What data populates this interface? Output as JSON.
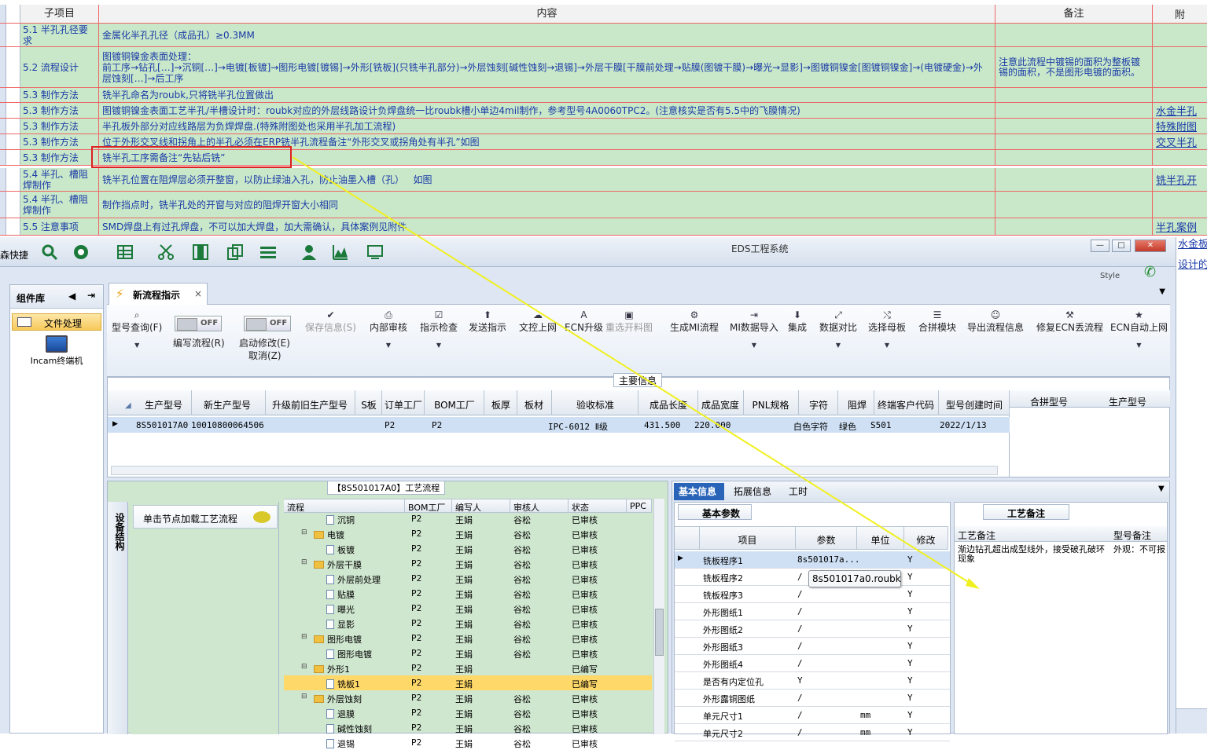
{
  "sheet": {
    "headers": {
      "sub": "子项目",
      "content": "内容",
      "remark": "备注",
      "attach": "附"
    },
    "rows": [
      {
        "sub": "5.1 半孔孔径要求",
        "content": "金属化半孔孔径（成品孔）≥0.3MM",
        "remark": "",
        "attach": ""
      },
      {
        "sub": "5.2 流程设计",
        "content": "图镀铜镍金表面处理：\n前工序→钻孔[…]→沉铜[…]→电镀[板镀]→图形电镀[镀锡]→外形[铣板](只铣半孔部分)→外层蚀刻[碱性蚀刻→退锡]→外层干膜[干膜前处理→贴膜(图镀干膜)→曝光→显影]→图镀铜镍金[图镀铜镍金]→(电镀硬金)→外层蚀刻[…]→后工序",
        "remark": "注意此流程中镀锡的面积为整板镀锡的面积，不是图形电镀的面积。",
        "attach": ""
      },
      {
        "sub": "5.3 制作方法",
        "content": "铣半孔命名为roubk,只将铣半孔位置做出",
        "remark": "",
        "attach": ""
      },
      {
        "sub": "5.3 制作方法",
        "content": "图镀铜镍金表面工艺半孔/半槽设计时：roubk对应的外层线路设计负焊盘统一比roubk槽小单边4mil制作，参考型号4A0060TPC2。(注意核实是否有5.5中的飞膜情况)",
        "remark": "",
        "attach": "水金半孔"
      },
      {
        "sub": "5.3 制作方法",
        "content": "半孔板外部分对应线路层为负焊焊盘.(特殊附图处也采用半孔加工流程)",
        "remark": "",
        "attach": "特殊附图"
      },
      {
        "sub": "5.3 制作方法",
        "content": "位于外形交叉线和拐角上的半孔必须在ERP铣半孔流程备注“外形交叉或拐角处有半孔”如图",
        "remark": "",
        "attach": "交叉半孔"
      },
      {
        "sub": "5.3 制作方法",
        "content": "铣半孔工序需备注“先钻后铣”",
        "remark": "",
        "attach": ""
      },
      {
        "sub": "5.4 半孔、槽阻焊制作",
        "content": "铣半孔位置在阻焊层必须开整窗，以防止绿油入孔，防止油墨入槽（孔）   如图",
        "remark": "",
        "attach": "铣半孔开"
      },
      {
        "sub": "5.4 半孔、槽阻焊制作",
        "content": "制作挡点时，铣半孔处的开窗与对应的阻焊开窗大小相同",
        "remark": "",
        "attach": ""
      },
      {
        "sub": "5.5 注意事项",
        "content": "SMD焊盘上有过孔焊盘，不可以加大焊盘，加大需确认，具体案例见附件",
        "remark": "",
        "attach": "半孔案例"
      }
    ]
  },
  "app": {
    "quick_label": "森快捷",
    "title": "EDS工程系统",
    "style_label": "Style",
    "window_controls": [
      "—",
      "□",
      "✕"
    ],
    "toolbar_icons": [
      "search-icon",
      "globe-icon",
      "table-icon",
      "scissors-icon",
      "film-icon",
      "copy-icon",
      "list-icon",
      "user-icon",
      "chart-icon",
      "monitor-icon"
    ]
  },
  "left": {
    "header": "组件库",
    "item": "文件处理",
    "terminal": "Incam终端机"
  },
  "tab": {
    "label": "新流程指示",
    "close": "×"
  },
  "ribbon": {
    "query": "型号查询(F)",
    "toggle1": "OFF",
    "toggle2": "OFF",
    "edit_flow": "编写流程(R)",
    "start_edit": "启动修改(E)",
    "cancel": "取消(Z)",
    "save": "保存信息(S)",
    "buttons": [
      "内部审核",
      "指示检查",
      "发送指示",
      "文控上网",
      "ECN升级",
      "重选开料图",
      "生成MI流程",
      "MI数据导入",
      "集成",
      "数据对比",
      "选择母板",
      "合拼模块",
      "导出流程信息",
      "修复ECN丢流程",
      "ECN自动上网"
    ]
  },
  "main_info": {
    "label": "主要信息",
    "headers": [
      "生产型号",
      "新生产型号",
      "升级前旧生产型号",
      "S板",
      "订单工厂",
      "BOM工厂",
      "板厚",
      "板材",
      "验收标准",
      "成品长度",
      "成品宽度",
      "PNL规格",
      "字符",
      "阻焊",
      "终端客户代码",
      "型号创建时间"
    ],
    "row": [
      "8S501017A0",
      "10010800064506",
      "",
      "",
      "P2",
      "P2",
      "",
      "",
      "IPC-6012 Ⅱ级",
      "431.500",
      "220.000",
      "",
      "白色字符",
      "绿色",
      "S501",
      "2022/1/13"
    ],
    "side_headers": [
      "合拼型号",
      "生产型号"
    ]
  },
  "flow": {
    "title": "【8S501017A0】工艺流程",
    "side_tab": "设备结构",
    "load_btn": "单击节点加载工艺流程",
    "headers": [
      "流程",
      "BOM工厂",
      "编写人",
      "审核人",
      "状态",
      "PPC"
    ],
    "rows": [
      {
        "level": 2,
        "kind": "file",
        "name": "沉铜",
        "bom": "P2",
        "writer": "王娟",
        "reviewer": "谷松",
        "status": "已审核"
      },
      {
        "level": 1,
        "kind": "folder",
        "name": "电镀",
        "bom": "P2",
        "writer": "王娟",
        "reviewer": "谷松",
        "status": "已审核"
      },
      {
        "level": 2,
        "kind": "file",
        "name": "板镀",
        "bom": "P2",
        "writer": "王娟",
        "reviewer": "谷松",
        "status": "已审核"
      },
      {
        "level": 1,
        "kind": "folder",
        "name": "外层干膜",
        "bom": "P2",
        "writer": "王娟",
        "reviewer": "谷松",
        "status": "已审核"
      },
      {
        "level": 2,
        "kind": "file",
        "name": "外层前处理",
        "bom": "P2",
        "writer": "王娟",
        "reviewer": "谷松",
        "status": "已审核"
      },
      {
        "level": 2,
        "kind": "file",
        "name": "贴膜",
        "bom": "P2",
        "writer": "王娟",
        "reviewer": "谷松",
        "status": "已审核"
      },
      {
        "level": 2,
        "kind": "file",
        "name": "曝光",
        "bom": "P2",
        "writer": "王娟",
        "reviewer": "谷松",
        "status": "已审核"
      },
      {
        "level": 2,
        "kind": "file",
        "name": "显影",
        "bom": "P2",
        "writer": "王娟",
        "reviewer": "谷松",
        "status": "已审核"
      },
      {
        "level": 1,
        "kind": "folder",
        "name": "图形电镀",
        "bom": "P2",
        "writer": "王娟",
        "reviewer": "谷松",
        "status": "已审核"
      },
      {
        "level": 2,
        "kind": "file",
        "name": "图形电镀",
        "bom": "P2",
        "writer": "王娟",
        "reviewer": "谷松",
        "status": "已审核"
      },
      {
        "level": 1,
        "kind": "folder",
        "name": "外形1",
        "bom": "P2",
        "writer": "王娟",
        "reviewer": "",
        "status": "已编写"
      },
      {
        "level": 2,
        "kind": "file",
        "name": "铣板1",
        "bom": "P2",
        "writer": "王娟",
        "reviewer": "",
        "status": "已编写",
        "selected": true
      },
      {
        "level": 1,
        "kind": "folder",
        "name": "外层蚀刻",
        "bom": "P2",
        "writer": "王娟",
        "reviewer": "谷松",
        "status": "已审核"
      },
      {
        "level": 2,
        "kind": "file",
        "name": "退膜",
        "bom": "P2",
        "writer": "王娟",
        "reviewer": "谷松",
        "status": "已审核"
      },
      {
        "level": 2,
        "kind": "file",
        "name": "碱性蚀刻",
        "bom": "P2",
        "writer": "王娟",
        "reviewer": "谷松",
        "status": "已审核"
      },
      {
        "level": 2,
        "kind": "file",
        "name": "退锡",
        "bom": "P2",
        "writer": "王娟",
        "reviewer": "谷松",
        "status": "已审核"
      }
    ]
  },
  "details": {
    "tabs": [
      "基本信息",
      "拓展信息",
      "工时"
    ],
    "param_tab": "基本参数",
    "headers": [
      "项目",
      "参数",
      "单位",
      "修改"
    ],
    "rows": [
      {
        "item": "铣板程序1",
        "param": "8s501017a...",
        "unit": "",
        "mod": "Y"
      },
      {
        "item": "铣板程序2",
        "param": "/",
        "unit": "",
        "mod": "Y"
      },
      {
        "item": "铣板程序3",
        "param": "/",
        "unit": "",
        "mod": "Y"
      },
      {
        "item": "外形图纸1",
        "param": "/",
        "unit": "",
        "mod": "Y"
      },
      {
        "item": "外形图纸2",
        "param": "/",
        "unit": "",
        "mod": "Y"
      },
      {
        "item": "外形图纸3",
        "param": "/",
        "unit": "",
        "mod": "Y"
      },
      {
        "item": "外形图纸4",
        "param": "/",
        "unit": "",
        "mod": "Y"
      },
      {
        "item": "是否有内定位孔",
        "param": "Y",
        "unit": "",
        "mod": "Y"
      },
      {
        "item": "外形露铜图纸",
        "param": "/",
        "unit": "",
        "mod": "Y"
      },
      {
        "item": "单元尺寸1",
        "param": "/",
        "unit": "mm",
        "mod": "Y"
      },
      {
        "item": "单元尺寸2",
        "param": "/",
        "unit": "mm",
        "mod": "Y"
      }
    ],
    "tooltip": "8s501017a0.roubk",
    "note_tab": "工艺备注",
    "note_headers": [
      "工艺备注",
      "型号备注"
    ],
    "note_text": "渐边钻孔超出成型线外，接受破孔破环现象",
    "model_note": "外观：不可报废板一"
  },
  "right_strip": [
    "水金板半",
    "设计的"
  ]
}
